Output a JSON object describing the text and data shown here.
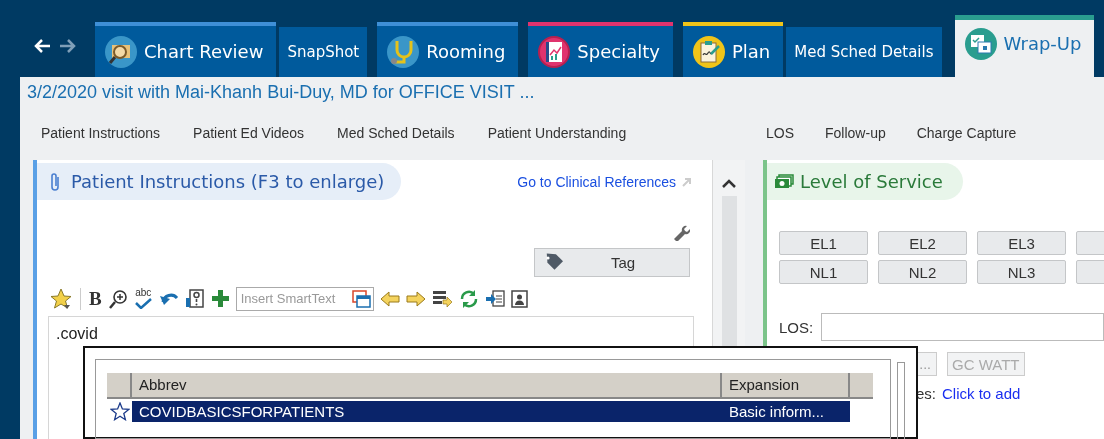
{
  "nav": {
    "back_enabled": true,
    "forward_enabled": false
  },
  "tabs": [
    {
      "label": "Chart Review",
      "kind": "main",
      "color": "#3f8fd6",
      "selected": false
    },
    {
      "label": "SnapShot",
      "kind": "sub",
      "selected": false
    },
    {
      "label": "Rooming",
      "kind": "main",
      "color": "#3f8fd6",
      "selected": false
    },
    {
      "label": "Specialty",
      "kind": "main",
      "color": "#e0336e",
      "selected": false
    },
    {
      "label": "Plan",
      "kind": "main",
      "color": "#f0c419",
      "selected": false
    },
    {
      "label": "Med Sched Details",
      "kind": "sub",
      "selected": false
    },
    {
      "label": "Wrap-Up",
      "kind": "main",
      "color": "#2a9d8f",
      "selected": true
    }
  ],
  "visit_title": "3/2/2020 visit with Mai-Khanh Bui-Duy, MD for OFFICE VISIT ...",
  "section_nav": {
    "left": [
      "Patient Instructions",
      "Patient Ed Videos",
      "Med Sched Details",
      "Patient Understanding"
    ],
    "right": [
      "LOS",
      "Follow-up",
      "Charge Capture"
    ]
  },
  "instructions": {
    "title": "Patient Instructions (F3 to enlarge)",
    "link": "Go to Clinical References",
    "tag_button": "Tag",
    "bold_button": "B",
    "spellcheck_label": "abc",
    "smarttext_placeholder": "Insert SmartText",
    "text": ".covid"
  },
  "los": {
    "title": "Level of Service",
    "button_rows": [
      [
        "EL1",
        "EL2",
        "EL3"
      ],
      [
        "NL1",
        "NL2",
        "NL3"
      ]
    ],
    "los_label": "LOS:",
    "more_button": "...",
    "gc_watt_button": {
      "label": "GC WATT",
      "disabled": true
    },
    "label_fragment": "es:",
    "add_link": "Click to add"
  },
  "smarttext_popup": {
    "columns": [
      "Abbrev",
      "Expansion"
    ],
    "rows": [
      {
        "favorite": false,
        "abbrev": "COVIDBASICSFORPATIENTS",
        "expansion": "Basic inform...",
        "selected": true
      }
    ]
  }
}
